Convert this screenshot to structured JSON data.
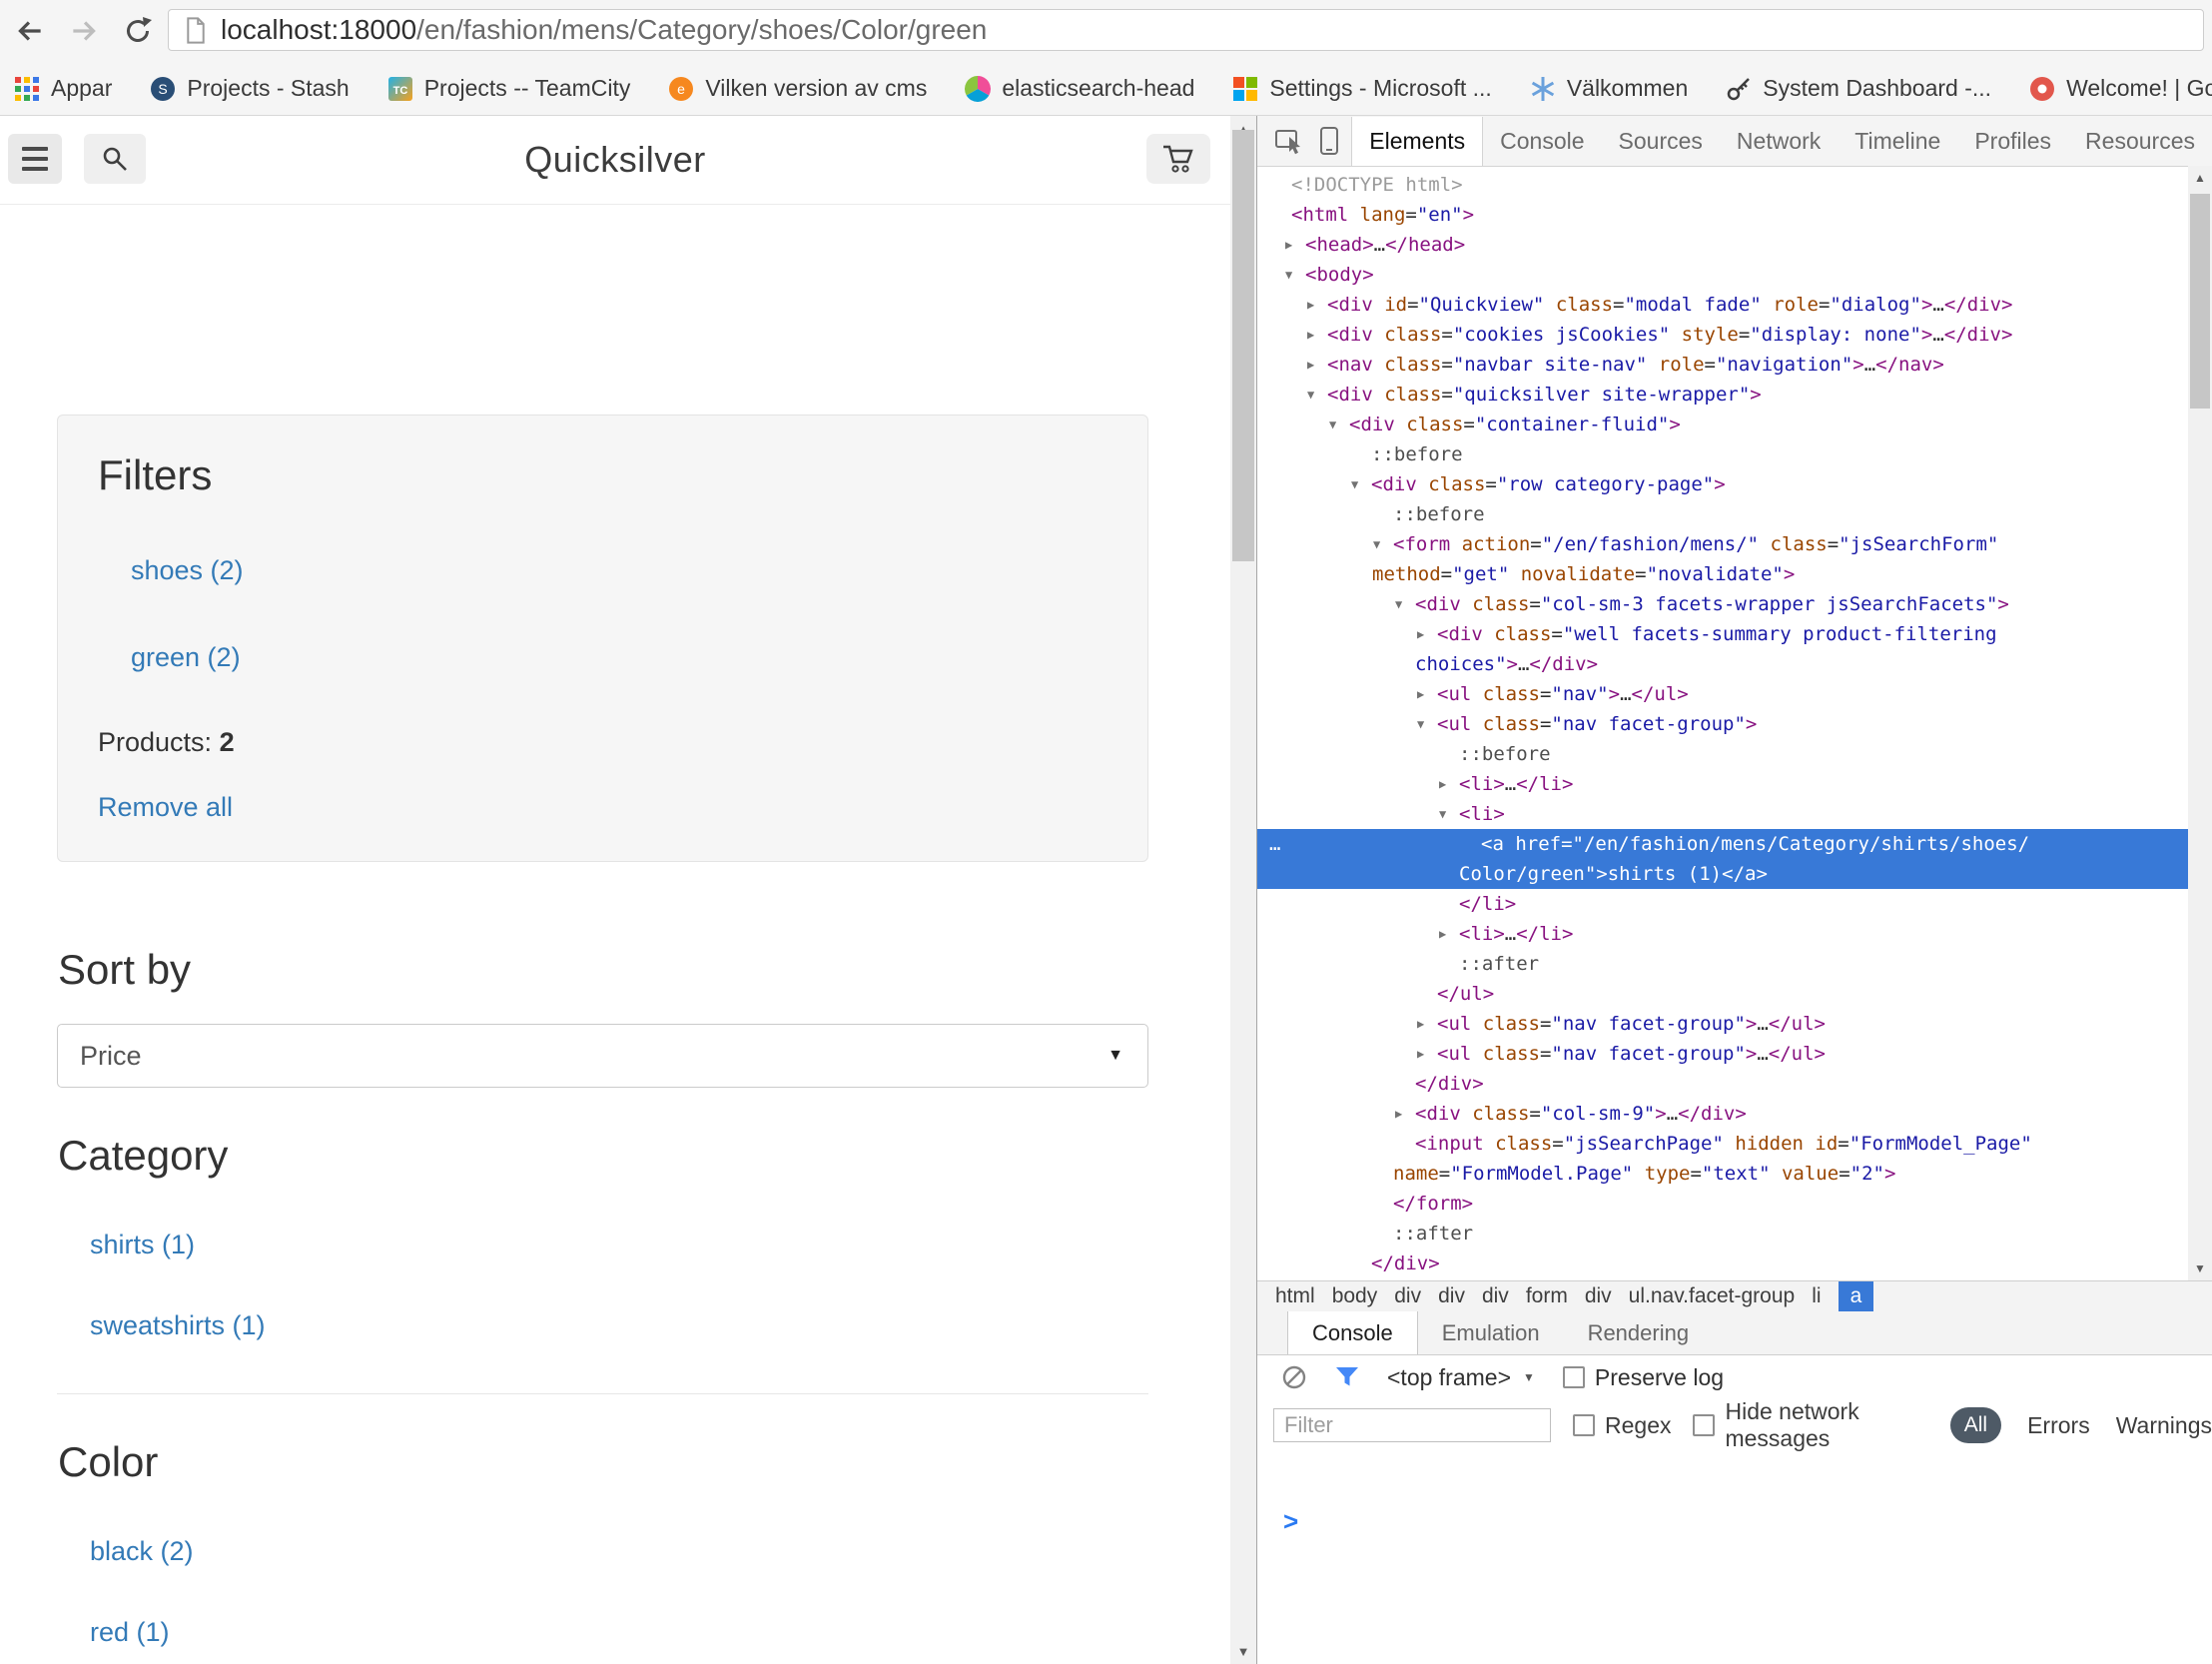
{
  "browser": {
    "url_host": "localhost:18000",
    "url_path": "/en/fashion/mens/Category/shoes/Color/green",
    "bookmarks": [
      {
        "label": "Appar",
        "icon": "apps-grid"
      },
      {
        "label": "Projects - Stash",
        "icon": "stash"
      },
      {
        "label": "Projects -- TeamCity",
        "icon": "teamcity"
      },
      {
        "label": "Vilken version av cms",
        "icon": "cms"
      },
      {
        "label": "elasticsearch-head",
        "icon": "elasticsearch"
      },
      {
        "label": "Settings - Microsoft ...",
        "icon": "microsoft"
      },
      {
        "label": "Välkommen",
        "icon": "snowflake"
      },
      {
        "label": "System Dashboard -...",
        "icon": "dashboard"
      },
      {
        "label": "Welcome! | GoTo...",
        "icon": "goto"
      }
    ]
  },
  "page": {
    "title": "Quicksilver",
    "filters": {
      "heading": "Filters",
      "links": [
        "shoes (2)",
        "green (2)"
      ],
      "products_label": "Products:",
      "products_count": "2",
      "remove_all": "Remove all"
    },
    "sort": {
      "heading": "Sort by",
      "selected": "Price"
    },
    "sections": [
      {
        "heading": "Category",
        "links": [
          "shirts (1)",
          "sweatshirts (1)"
        ]
      },
      {
        "heading": "Color",
        "links": [
          "black (2)",
          "red (1)"
        ]
      }
    ]
  },
  "devtools": {
    "tabs": [
      {
        "label": "Elements",
        "active": true
      },
      {
        "label": "Console"
      },
      {
        "label": "Sources"
      },
      {
        "label": "Network"
      },
      {
        "label": "Timeline"
      },
      {
        "label": "Profiles"
      },
      {
        "label": "Resources"
      }
    ],
    "dom_lines": [
      {
        "ind": 34,
        "tok": [
          [
            "g",
            "<!DOCTYPE html>"
          ]
        ]
      },
      {
        "ind": 34,
        "tok": [
          [
            "t",
            "<html"
          ],
          [
            "a",
            " lang"
          ],
          [
            "d",
            "="
          ],
          [
            "v",
            "\"en\""
          ],
          [
            "t",
            ">"
          ]
        ]
      },
      {
        "ind": 48,
        "ar": "r",
        "tok": [
          [
            "t",
            "<head>"
          ],
          [
            "d",
            "…"
          ],
          [
            "t",
            "</head>"
          ]
        ]
      },
      {
        "ind": 48,
        "ar": "d",
        "tok": [
          [
            "t",
            "<body>"
          ]
        ]
      },
      {
        "ind": 70,
        "ar": "r",
        "tok": [
          [
            "t",
            "<div"
          ],
          [
            "a",
            " id"
          ],
          [
            "d",
            "="
          ],
          [
            "v",
            "\"Quickview\""
          ],
          [
            "a",
            " class"
          ],
          [
            "d",
            "="
          ],
          [
            "v",
            "\"modal fade\""
          ],
          [
            "a",
            " role"
          ],
          [
            "d",
            "="
          ],
          [
            "v",
            "\"dialog\""
          ],
          [
            "t",
            ">"
          ],
          [
            "d",
            "…"
          ],
          [
            "t",
            "</div>"
          ]
        ]
      },
      {
        "ind": 70,
        "ar": "r",
        "tok": [
          [
            "t",
            "<div"
          ],
          [
            "a",
            " class"
          ],
          [
            "d",
            "="
          ],
          [
            "v",
            "\"cookies jsCookies\""
          ],
          [
            "a",
            " style"
          ],
          [
            "d",
            "="
          ],
          [
            "v",
            "\"display: none\""
          ],
          [
            "t",
            ">"
          ],
          [
            "d",
            "…"
          ],
          [
            "t",
            "</div>"
          ]
        ]
      },
      {
        "ind": 70,
        "ar": "r",
        "tok": [
          [
            "t",
            "<nav"
          ],
          [
            "a",
            " class"
          ],
          [
            "d",
            "="
          ],
          [
            "v",
            "\"navbar site-nav\""
          ],
          [
            "a",
            " role"
          ],
          [
            "d",
            "="
          ],
          [
            "v",
            "\"navigation\""
          ],
          [
            "t",
            ">"
          ],
          [
            "d",
            "…"
          ],
          [
            "t",
            "</nav>"
          ]
        ]
      },
      {
        "ind": 70,
        "ar": "d",
        "tok": [
          [
            "t",
            "<div"
          ],
          [
            "a",
            " class"
          ],
          [
            "d",
            "="
          ],
          [
            "v",
            "\"quicksilver site-wrapper\""
          ],
          [
            "t",
            ">"
          ]
        ]
      },
      {
        "ind": 92,
        "ar": "d",
        "tok": [
          [
            "t",
            "<div"
          ],
          [
            "a",
            " class"
          ],
          [
            "d",
            "="
          ],
          [
            "v",
            "\"container-fluid\""
          ],
          [
            "t",
            ">"
          ]
        ]
      },
      {
        "ind": 114,
        "tok": [
          [
            "p",
            "::before"
          ]
        ]
      },
      {
        "ind": 114,
        "ar": "d",
        "tok": [
          [
            "t",
            "<div"
          ],
          [
            "a",
            " class"
          ],
          [
            "d",
            "="
          ],
          [
            "v",
            "\"row category-page\""
          ],
          [
            "t",
            ">"
          ]
        ]
      },
      {
        "ind": 136,
        "tok": [
          [
            "p",
            "::before"
          ]
        ]
      },
      {
        "ind": 136,
        "ar": "d",
        "tok": [
          [
            "t",
            "<form"
          ],
          [
            "a",
            " action"
          ],
          [
            "d",
            "="
          ],
          [
            "v",
            "\"/en/fashion/mens/\""
          ],
          [
            "a",
            " class"
          ],
          [
            "d",
            "="
          ],
          [
            "v",
            "\"jsSearchForm\""
          ]
        ]
      },
      {
        "ind": 115,
        "tok": [
          [
            "a",
            "method"
          ],
          [
            "d",
            "="
          ],
          [
            "v",
            "\"get\""
          ],
          [
            "a",
            " novalidate"
          ],
          [
            "d",
            "="
          ],
          [
            "v",
            "\"novalidate\""
          ],
          [
            "t",
            ">"
          ]
        ]
      },
      {
        "ind": 158,
        "ar": "d",
        "tok": [
          [
            "t",
            "<div"
          ],
          [
            "a",
            " class"
          ],
          [
            "d",
            "="
          ],
          [
            "v",
            "\"col-sm-3 facets-wrapper jsSearchFacets\""
          ],
          [
            "t",
            ">"
          ]
        ]
      },
      {
        "ind": 180,
        "ar": "r",
        "tok": [
          [
            "t",
            "<div"
          ],
          [
            "a",
            " class"
          ],
          [
            "d",
            "="
          ],
          [
            "v",
            "\"well facets-summary product-filtering"
          ]
        ]
      },
      {
        "ind": 158,
        "tok": [
          [
            "v",
            "choices\""
          ],
          [
            "t",
            ">"
          ],
          [
            "d",
            "…"
          ],
          [
            "t",
            "</div>"
          ]
        ]
      },
      {
        "ind": 180,
        "ar": "r",
        "tok": [
          [
            "t",
            "<ul"
          ],
          [
            "a",
            " class"
          ],
          [
            "d",
            "="
          ],
          [
            "v",
            "\"nav\""
          ],
          [
            "t",
            ">"
          ],
          [
            "d",
            "…"
          ],
          [
            "t",
            "</ul>"
          ]
        ]
      },
      {
        "ind": 180,
        "ar": "d",
        "tok": [
          [
            "t",
            "<ul"
          ],
          [
            "a",
            " class"
          ],
          [
            "d",
            "="
          ],
          [
            "v",
            "\"nav facet-group\""
          ],
          [
            "t",
            ">"
          ]
        ]
      },
      {
        "ind": 202,
        "tok": [
          [
            "p",
            "::before"
          ]
        ]
      },
      {
        "ind": 202,
        "ar": "r",
        "tok": [
          [
            "t",
            "<li>"
          ],
          [
            "d",
            "…"
          ],
          [
            "t",
            "</li>"
          ]
        ]
      },
      {
        "ind": 202,
        "ar": "d",
        "tok": [
          [
            "t",
            "<li>"
          ]
        ]
      },
      {
        "ind": 224,
        "hl": true,
        "dots": true,
        "tok": [
          [
            "t",
            "<a"
          ],
          [
            "a",
            " href"
          ],
          [
            "d",
            "="
          ],
          [
            "v",
            "\"/en/fashion/mens/Category/shirts/shoes/"
          ]
        ]
      },
      {
        "ind": 202,
        "hl": true,
        "tok": [
          [
            "v",
            "Color/green\""
          ],
          [
            "t",
            ">"
          ],
          [
            "x",
            "shirts (1)"
          ],
          [
            "t",
            "</a>"
          ]
        ]
      },
      {
        "ind": 202,
        "tok": [
          [
            "t",
            "</li>"
          ]
        ]
      },
      {
        "ind": 202,
        "ar": "r",
        "tok": [
          [
            "t",
            "<li>"
          ],
          [
            "d",
            "…"
          ],
          [
            "t",
            "</li>"
          ]
        ]
      },
      {
        "ind": 202,
        "tok": [
          [
            "p",
            "::after"
          ]
        ]
      },
      {
        "ind": 180,
        "tok": [
          [
            "t",
            "</ul>"
          ]
        ]
      },
      {
        "ind": 180,
        "ar": "r",
        "tok": [
          [
            "t",
            "<ul"
          ],
          [
            "a",
            " class"
          ],
          [
            "d",
            "="
          ],
          [
            "v",
            "\"nav facet-group\""
          ],
          [
            "t",
            ">"
          ],
          [
            "d",
            "…"
          ],
          [
            "t",
            "</ul>"
          ]
        ]
      },
      {
        "ind": 180,
        "ar": "r",
        "tok": [
          [
            "t",
            "<ul"
          ],
          [
            "a",
            " class"
          ],
          [
            "d",
            "="
          ],
          [
            "v",
            "\"nav facet-group\""
          ],
          [
            "t",
            ">"
          ],
          [
            "d",
            "…"
          ],
          [
            "t",
            "</ul>"
          ]
        ]
      },
      {
        "ind": 158,
        "tok": [
          [
            "t",
            "</div>"
          ]
        ]
      },
      {
        "ind": 158,
        "ar": "r",
        "tok": [
          [
            "t",
            "<div"
          ],
          [
            "a",
            " class"
          ],
          [
            "d",
            "="
          ],
          [
            "v",
            "\"col-sm-9\""
          ],
          [
            "t",
            ">"
          ],
          [
            "d",
            "…"
          ],
          [
            "t",
            "</div>"
          ]
        ]
      },
      {
        "ind": 158,
        "tok": [
          [
            "t",
            "<input"
          ],
          [
            "a",
            " class"
          ],
          [
            "d",
            "="
          ],
          [
            "v",
            "\"jsSearchPage\""
          ],
          [
            "a",
            " hidden"
          ],
          [
            "a",
            " id"
          ],
          [
            "d",
            "="
          ],
          [
            "v",
            "\"FormModel_Page\""
          ]
        ]
      },
      {
        "ind": 136,
        "tok": [
          [
            "a",
            "name"
          ],
          [
            "d",
            "="
          ],
          [
            "v",
            "\"FormModel.Page\""
          ],
          [
            "a",
            " type"
          ],
          [
            "d",
            "="
          ],
          [
            "v",
            "\"text\""
          ],
          [
            "a",
            " value"
          ],
          [
            "d",
            "="
          ],
          [
            "v",
            "\"2\""
          ],
          [
            "t",
            ">"
          ]
        ]
      },
      {
        "ind": 136,
        "tok": [
          [
            "t",
            "</form>"
          ]
        ]
      },
      {
        "ind": 136,
        "tok": [
          [
            "p",
            "::after"
          ]
        ]
      },
      {
        "ind": 114,
        "tok": [
          [
            "t",
            "</div>"
          ]
        ]
      }
    ],
    "breadcrumbs": [
      {
        "label": "html"
      },
      {
        "label": "body"
      },
      {
        "label": "div"
      },
      {
        "label": "div"
      },
      {
        "label": "div"
      },
      {
        "label": "form"
      },
      {
        "label": "div"
      },
      {
        "label": "ul.nav.facet-group"
      },
      {
        "label": "li"
      },
      {
        "label": "a",
        "active": true
      }
    ],
    "drawer": {
      "tabs": [
        {
          "label": "Console",
          "active": true
        },
        {
          "label": "Emulation"
        },
        {
          "label": "Rendering"
        }
      ],
      "frame_selector": "<top frame>",
      "preserve_log_label": "Preserve log",
      "filter_placeholder": "Filter",
      "regex_label": "Regex",
      "hide_network_label": "Hide network messages",
      "levels": [
        {
          "label": "All",
          "active": true
        },
        {
          "label": "Errors"
        },
        {
          "label": "Warnings"
        }
      ]
    }
  },
  "colors": {
    "selection_blue": "#3879d7",
    "link_blue": "#337ab7",
    "tag_purple": "#881280",
    "attr_orange": "#994500",
    "value_blue": "#1a1aa6"
  }
}
